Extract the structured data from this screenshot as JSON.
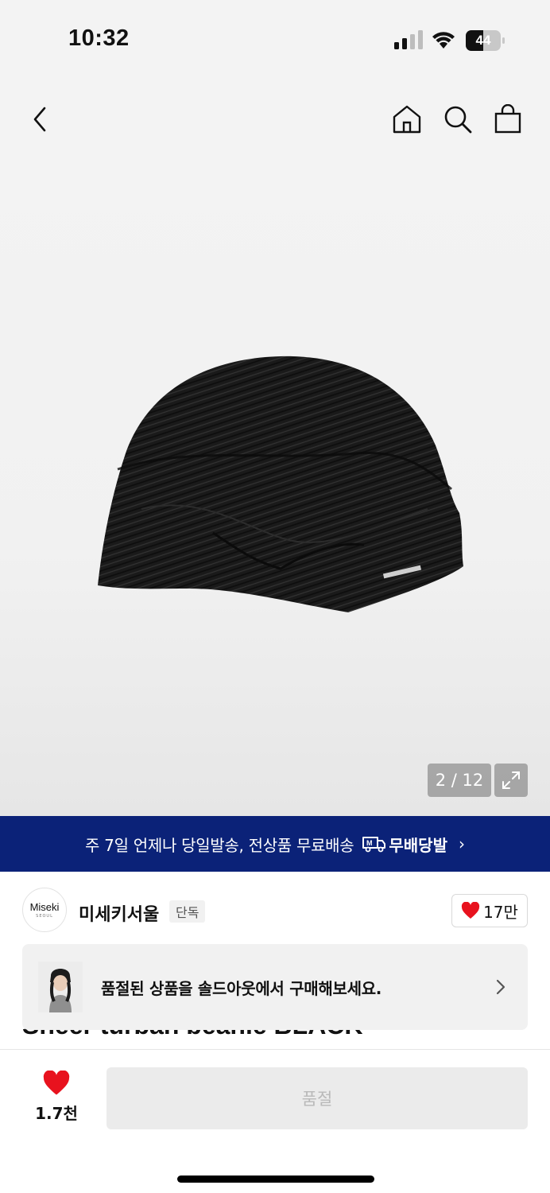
{
  "status_bar": {
    "time": "10:32",
    "battery": "44"
  },
  "nav": {
    "back_icon": "chevron-left-icon",
    "home_icon": "home-icon",
    "search_icon": "search-icon",
    "cart_icon": "shopping-bag-icon"
  },
  "gallery": {
    "indicator": "2 / 12"
  },
  "promo": {
    "text": "주 7일 언제나 당일발송, 전상품 무료배송",
    "badge": "무배당발",
    "background": "#0b2278"
  },
  "store": {
    "logo_text": "Miseki",
    "logo_sub": "SEOUL",
    "name": "미세키서울",
    "tag": "단독",
    "likes": "17만"
  },
  "soldout_banner": {
    "text": "품절된 상품을 솔드아웃에서 구매해보세요."
  },
  "product": {
    "title": "Sheer turban beanie BLACK"
  },
  "bottom_bar": {
    "wish_count": "1.7천",
    "buy_label": "품절"
  },
  "colors": {
    "heart": "#e8121e",
    "promo_bg": "#0b2278"
  }
}
